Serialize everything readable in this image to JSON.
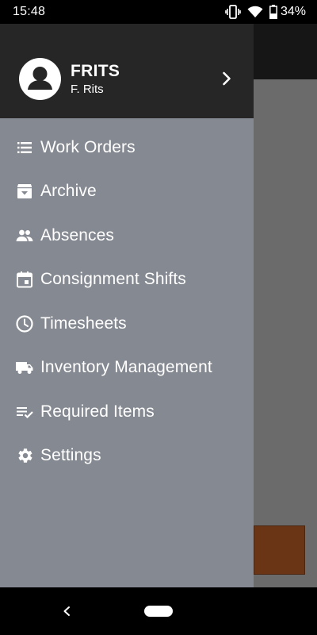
{
  "status_bar": {
    "time": "15:48",
    "battery": "34%",
    "icons": [
      "vibrate-icon",
      "wifi-icon",
      "battery-icon"
    ]
  },
  "drawer": {
    "user": {
      "name": "FRITS",
      "subtitle": "F. Rits"
    },
    "menu": [
      {
        "label": "Work Orders",
        "icon": "list-icon"
      },
      {
        "label": "Archive",
        "icon": "archive-icon"
      },
      {
        "label": "Absences",
        "icon": "people-icon"
      },
      {
        "label": "Consignment Shifts",
        "icon": "calendar-icon"
      },
      {
        "label": "Timesheets",
        "icon": "clock-icon"
      },
      {
        "label": "Inventory Management",
        "icon": "truck-icon"
      },
      {
        "label": "Required Items",
        "icon": "checklist-icon"
      },
      {
        "label": "Settings",
        "icon": "gear-icon"
      }
    ]
  },
  "colors": {
    "drawer_bg": "#858991",
    "header_bg": "#262626",
    "scrim": "#6b6b6b",
    "accent_card": "#6a3515"
  }
}
